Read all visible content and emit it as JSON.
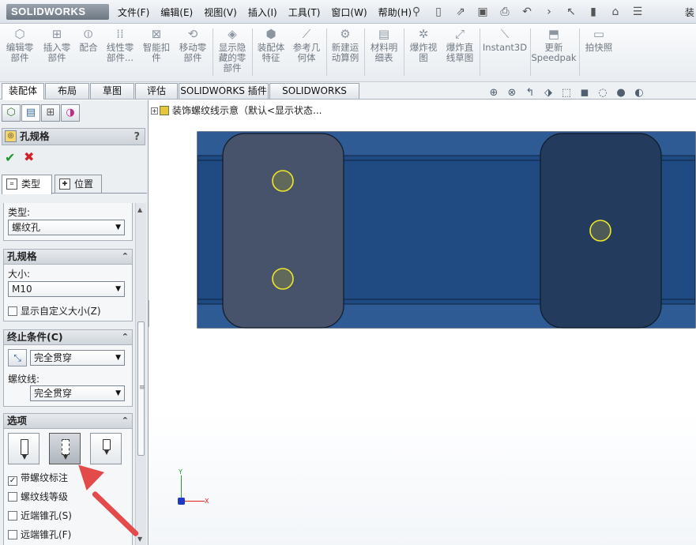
{
  "app": {
    "brand": "SOLIDWORKS",
    "menu": [
      "文件(F)",
      "编辑(E)",
      "视图(V)",
      "插入(I)",
      "工具(T)",
      "窗口(W)",
      "帮助(H)"
    ],
    "title_fragment": "装"
  },
  "commands": [
    {
      "label": "编辑零\n部件",
      "icon": "edit-part-icon"
    },
    {
      "label": "插入零\n部件",
      "icon": "insert-part-icon"
    },
    {
      "label": "配合",
      "icon": "mate-icon"
    },
    {
      "label": "线性零\n部件...",
      "icon": "linear-pattern-icon"
    },
    {
      "label": "智能扣\n件",
      "icon": "smart-fastener-icon"
    },
    {
      "label": "移动零\n部件",
      "icon": "move-part-icon"
    },
    {
      "label": "显示隐\n藏的零\n部件",
      "icon": "show-hidden-icon"
    },
    {
      "label": "装配体\n特征",
      "icon": "assembly-feature-icon"
    },
    {
      "label": "参考几\n何体",
      "icon": "reference-geometry-icon"
    },
    {
      "label": "新建运\n动算例",
      "icon": "motion-study-icon"
    },
    {
      "label": "材料明\n细表",
      "icon": "bom-icon"
    },
    {
      "label": "爆炸视\n图",
      "icon": "explode-view-icon"
    },
    {
      "label": "爆炸直\n线草图",
      "icon": "explode-line-icon"
    },
    {
      "label": "Instant3D",
      "icon": "instant3d-icon"
    },
    {
      "label": "更新\nSpeedpak",
      "icon": "speedpak-icon"
    },
    {
      "label": "拍快照",
      "icon": "snapshot-icon"
    }
  ],
  "tabs": [
    "装配体",
    "布局",
    "草图",
    "评估",
    "SOLIDWORKS 插件",
    "SOLIDWORKS MBD"
  ],
  "tree": {
    "root": "装饰螺纹线示意（默认<显示状态..."
  },
  "pm": {
    "title": "孔规格",
    "help": "?",
    "ok": "✔",
    "cancel": "✖",
    "subtab_type": "类型",
    "subtab_position": "位置",
    "type_label": "类型:",
    "type_value": "螺纹孔",
    "spec_group": "孔规格",
    "size_label": "大小:",
    "size_value": "M10",
    "custom_size": "显示自定义大小(Z)",
    "end_group": "终止条件(C)",
    "end_value": "完全贯穿",
    "thread_label": "螺纹线:",
    "thread_value": "完全贯穿",
    "options_group": "选项",
    "opt_cosmetic": "带螺纹标注",
    "opt_thread_class": "螺纹线等级",
    "opt_near_cs": "近端锥孔(S)",
    "opt_far_cs": "远端锥孔(F)"
  },
  "options_state": {
    "cosmetic_checked": true,
    "thread_class_checked": false,
    "near_cs_checked": false,
    "far_cs_checked": false
  },
  "colors": {
    "part_body": "#1f4a82",
    "part_face": "#2b5890",
    "pocket": "#46536a",
    "hole_outline": "#f0e62a",
    "hole_fill": "#616a5a",
    "arrow": "#e34a4a"
  },
  "axes": {
    "x": "X",
    "y": "Y"
  }
}
